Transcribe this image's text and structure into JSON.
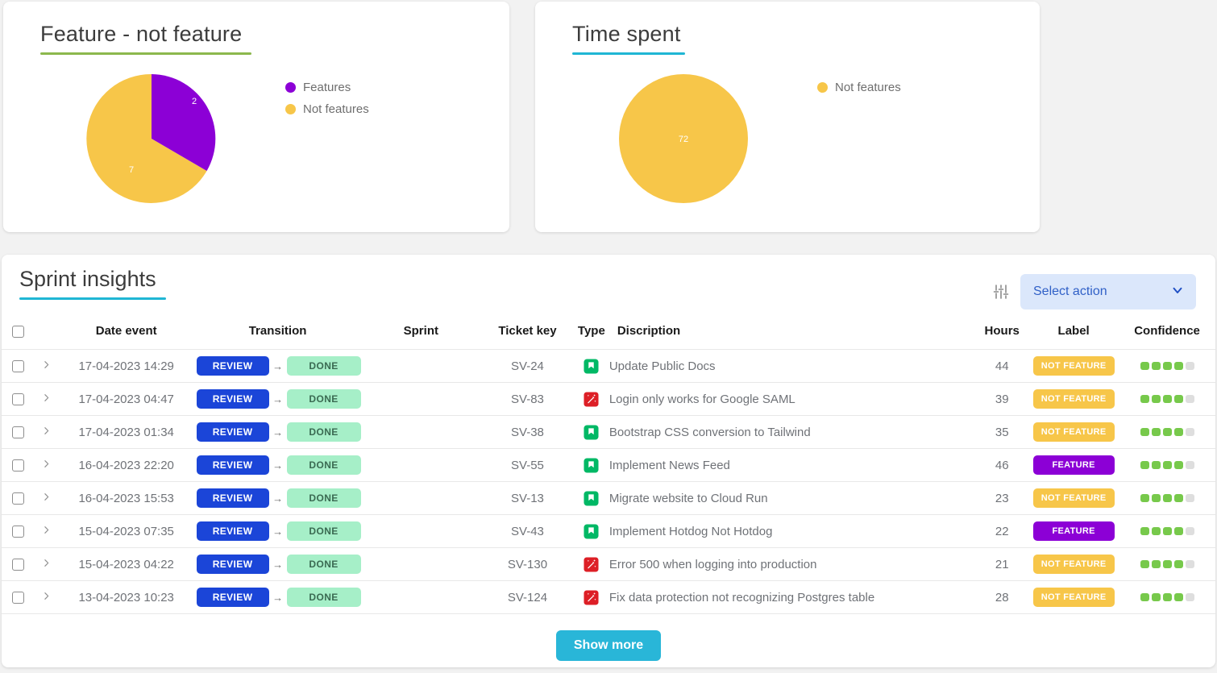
{
  "cards": {
    "feature": {
      "title": "Feature - not feature",
      "underline_color": "#8cb84d",
      "legend": [
        {
          "label": "Features",
          "color": "#8c00d6"
        },
        {
          "label": "Not features",
          "color": "#f7c649"
        }
      ]
    },
    "time": {
      "title": "Time spent",
      "underline_color": "#1fb6d4",
      "legend": [
        {
          "label": "Not features",
          "color": "#f7c649"
        }
      ]
    }
  },
  "chart_data": [
    {
      "type": "pie",
      "title": "Feature - not feature",
      "categories": [
        "Features",
        "Not features"
      ],
      "values": [
        2,
        7
      ],
      "labels": [
        "2",
        "7"
      ],
      "colors": [
        "#8c00d6",
        "#f7c649"
      ],
      "legend_position": "right"
    },
    {
      "type": "pie",
      "title": "Time spent",
      "categories": [
        "Not features"
      ],
      "values": [
        72
      ],
      "labels": [
        "72"
      ],
      "colors": [
        "#f7c649"
      ],
      "legend_position": "right"
    }
  ],
  "panel": {
    "title": "Sprint insights",
    "underline_color": "#1fb6d4",
    "tune_icon": "tune-sliders-icon",
    "select_action": {
      "label": "Select action",
      "chevron": "chevron-down-icon",
      "background": "#dbe7fb",
      "text_color": "#3060c7"
    },
    "show_more_label": "Show more",
    "show_more_color": "#29b6d8",
    "columns": [
      "",
      "",
      "Date event",
      "Transition",
      "Sprint",
      "Ticket key",
      "Type",
      "Discription",
      "Hours",
      "Label",
      "Confidence"
    ],
    "transition_arrow": "→",
    "rows": [
      {
        "date": "17-04-2023 14:29",
        "from": "REVIEW",
        "to": "DONE",
        "sprint": "",
        "key": "SV-24",
        "type": "story",
        "description": "Update Public Docs",
        "hours": "44",
        "label": "NOT FEATURE",
        "label_kind": "notfeature",
        "confidence": 4,
        "confidence_max": 5
      },
      {
        "date": "17-04-2023 04:47",
        "from": "REVIEW",
        "to": "DONE",
        "sprint": "",
        "key": "SV-83",
        "type": "bug",
        "description": "Login only works for Google SAML",
        "hours": "39",
        "label": "NOT FEATURE",
        "label_kind": "notfeature",
        "confidence": 4,
        "confidence_max": 5
      },
      {
        "date": "17-04-2023 01:34",
        "from": "REVIEW",
        "to": "DONE",
        "sprint": "",
        "key": "SV-38",
        "type": "story",
        "description": "Bootstrap CSS conversion to Tailwind",
        "hours": "35",
        "label": "NOT FEATURE",
        "label_kind": "notfeature",
        "confidence": 4,
        "confidence_max": 5
      },
      {
        "date": "16-04-2023 22:20",
        "from": "REVIEW",
        "to": "DONE",
        "sprint": "",
        "key": "SV-55",
        "type": "story",
        "description": "Implement News Feed",
        "hours": "46",
        "label": "FEATURE",
        "label_kind": "feature",
        "confidence": 4,
        "confidence_max": 5
      },
      {
        "date": "16-04-2023 15:53",
        "from": "REVIEW",
        "to": "DONE",
        "sprint": "",
        "key": "SV-13",
        "type": "story",
        "description": "Migrate website to Cloud Run",
        "hours": "23",
        "label": "NOT FEATURE",
        "label_kind": "notfeature",
        "confidence": 4,
        "confidence_max": 5
      },
      {
        "date": "15-04-2023 07:35",
        "from": "REVIEW",
        "to": "DONE",
        "sprint": "",
        "key": "SV-43",
        "type": "story",
        "description": "Implement Hotdog Not Hotdog",
        "hours": "22",
        "label": "FEATURE",
        "label_kind": "feature",
        "confidence": 4,
        "confidence_max": 5
      },
      {
        "date": "15-04-2023 04:22",
        "from": "REVIEW",
        "to": "DONE",
        "sprint": "",
        "key": "SV-130",
        "type": "bug",
        "description": "Error 500 when logging into production",
        "hours": "21",
        "label": "NOT FEATURE",
        "label_kind": "notfeature",
        "confidence": 4,
        "confidence_max": 5
      },
      {
        "date": "13-04-2023 10:23",
        "from": "REVIEW",
        "to": "DONE",
        "sprint": "",
        "key": "SV-124",
        "type": "bug",
        "description": "Fix data protection not recognizing Postgres table",
        "hours": "28",
        "label": "NOT FEATURE",
        "label_kind": "notfeature",
        "confidence": 4,
        "confidence_max": 5
      }
    ]
  }
}
